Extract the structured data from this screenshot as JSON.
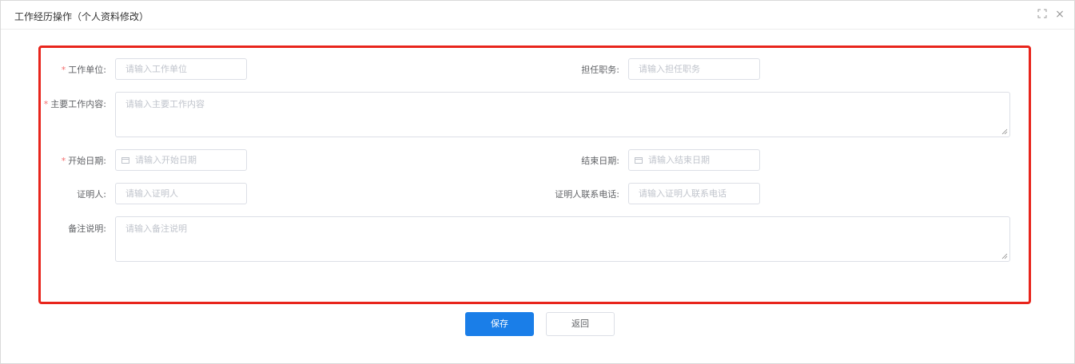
{
  "window": {
    "title": "工作经历操作（个人资料修改）",
    "maximize_icon": "⛶",
    "close_icon": "×"
  },
  "form": {
    "company": {
      "label": "工作单位:",
      "required": "*",
      "placeholder": "请输入工作单位"
    },
    "position": {
      "label": "担任职务:",
      "placeholder": "请输入担任职务"
    },
    "content": {
      "label": "主要工作内容:",
      "required": "*",
      "placeholder": "请输入主要工作内容"
    },
    "start_date": {
      "label": "开始日期:",
      "required": "*",
      "placeholder": "请输入开始日期"
    },
    "end_date": {
      "label": "结束日期:",
      "placeholder": "请输入结束日期"
    },
    "witness": {
      "label": "证明人:",
      "placeholder": "请输入证明人"
    },
    "witness_phone": {
      "label": "证明人联系电话:",
      "placeholder": "请输入证明人联系电话"
    },
    "remarks": {
      "label": "备注说明:",
      "placeholder": "请输入备注说明"
    }
  },
  "actions": {
    "save_label": "保存",
    "back_label": "返回"
  },
  "colors": {
    "primary": "#1a7ee8",
    "required": "#f56c6c",
    "highlight_frame": "#e8251c"
  }
}
